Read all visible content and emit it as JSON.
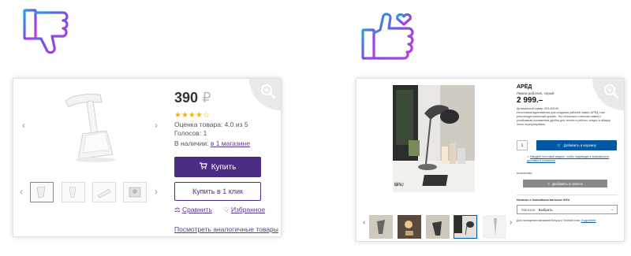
{
  "left_card": {
    "price": "390",
    "currency": "₽",
    "stars": "★★★★☆",
    "rating_text": "Оценка товара: 4.0 из 5",
    "votes_text": "Голосов: 1",
    "availability_prefix": "В наличии:",
    "availability_link": "в 1 магазине",
    "buy_label": "Купить",
    "one_click_label": "Купить в 1 клик",
    "compare_label": "Сравнить",
    "favorites_label": "Избранное",
    "similar_label": "Посмотреть аналогичные товары",
    "prev_arrow": "‹",
    "next_arrow": "›",
    "accent": "#4b2e83"
  },
  "right_card": {
    "title": "АРЁД",
    "subtitle": "Лампа рабочая, серый",
    "price": "2 999.–",
    "article": "Артикульный номер: 903.405.59",
    "description": "Источником вдохновения для создания рабочей лампы АРЁД стал ретроиндустриальный дизайн. Это гениально стальная лампа с устойчивым основанием удобна для чтения и работы, шнуры и абажур легко отрегулировать.",
    "qty": "1",
    "add_to_cart": "Добавить в корзину",
    "delivery_text": "Введите почтовый индекс, чтобы подтвердить возможность доставки и стоимость",
    "quantity_label": "Количество:",
    "add_to_list": "Добавить в список",
    "store_label": "Наличие в ближайшем магазине IKEA",
    "store_prefix": "Магазин:",
    "store_value": "Выбрать",
    "store_note": "Для посещения магазина бонуса в Теплый стан.",
    "store_link": "Подробнее",
    "prev_arrow": "‹",
    "next_arrow": "›",
    "brand_blue": "#0058a3"
  },
  "icons": {
    "thumbs_down": "thumbs-down-icon",
    "thumbs_up_heart": "thumbs-up-heart-icon",
    "zoom": "zoom-in-icon"
  }
}
